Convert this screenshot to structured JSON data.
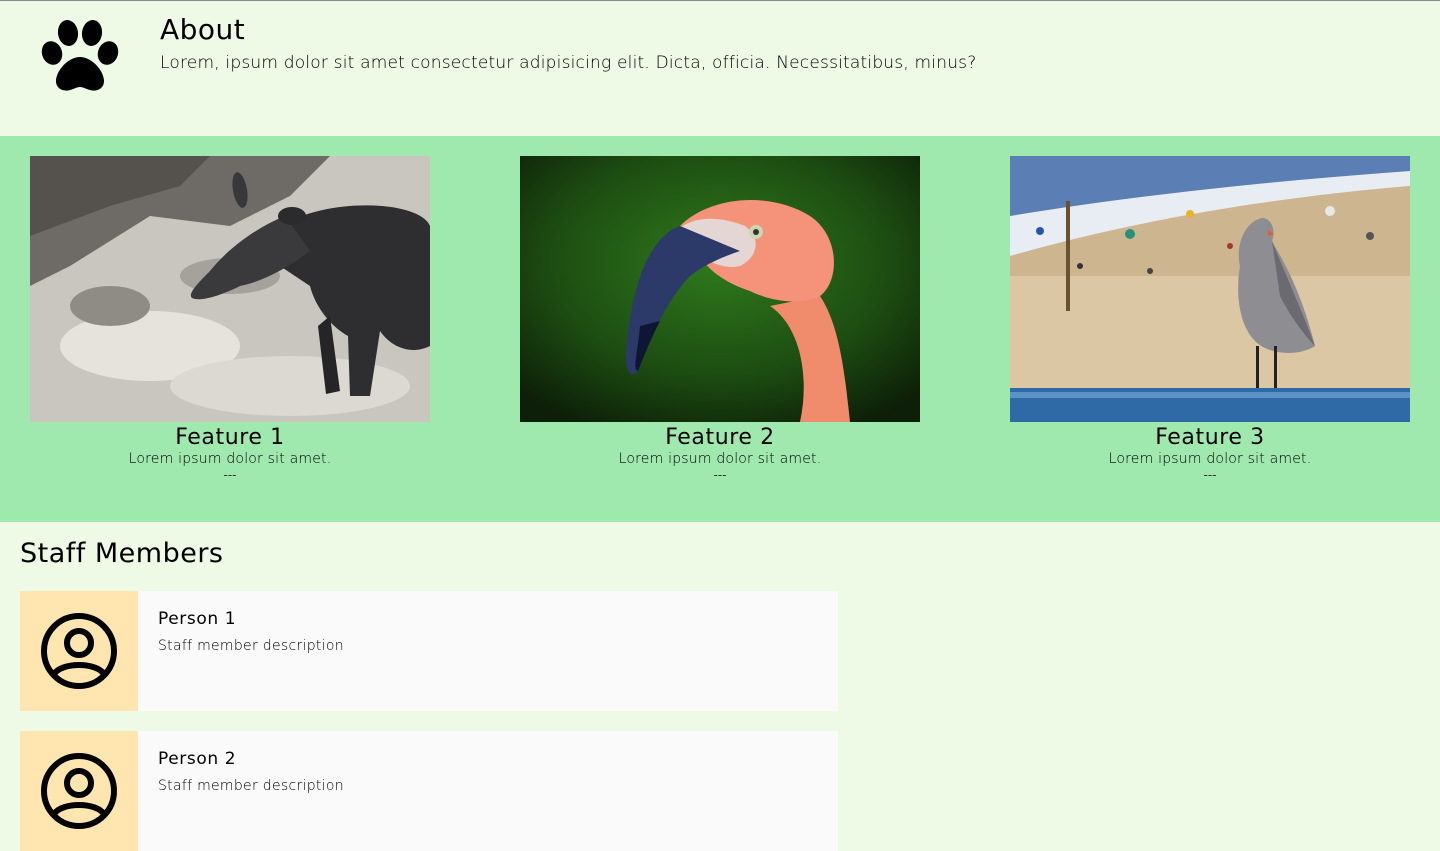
{
  "about": {
    "title": "About",
    "text": "Lorem, ipsum dolor sit amet consectetur adipisicing elit. Dicta, officia. Necessitatibus, minus?",
    "icon": "paw-icon"
  },
  "features": [
    {
      "title": "Feature 1",
      "desc": "Lorem ipsum dolor sit amet.",
      "sep": "---",
      "image": "tapir-photo"
    },
    {
      "title": "Feature 2",
      "desc": "Lorem ipsum dolor sit amet.",
      "sep": "---",
      "image": "flamingo-photo"
    },
    {
      "title": "Feature 3",
      "desc": "Lorem ipsum dolor sit amet.",
      "sep": "---",
      "image": "seagull-beach-photo"
    }
  ],
  "staff": {
    "title": "Staff Members",
    "members": [
      {
        "name": "Person 1",
        "desc": "Staff member description",
        "icon": "user-avatar-icon"
      },
      {
        "name": "Person 2",
        "desc": "Staff member description",
        "icon": "user-avatar-icon"
      }
    ]
  },
  "colors": {
    "page_bg": "#eef9e6",
    "features_bg": "#9fe8ae",
    "avatar_bg": "#ffe5b0",
    "card_bg": "#fafafa"
  }
}
